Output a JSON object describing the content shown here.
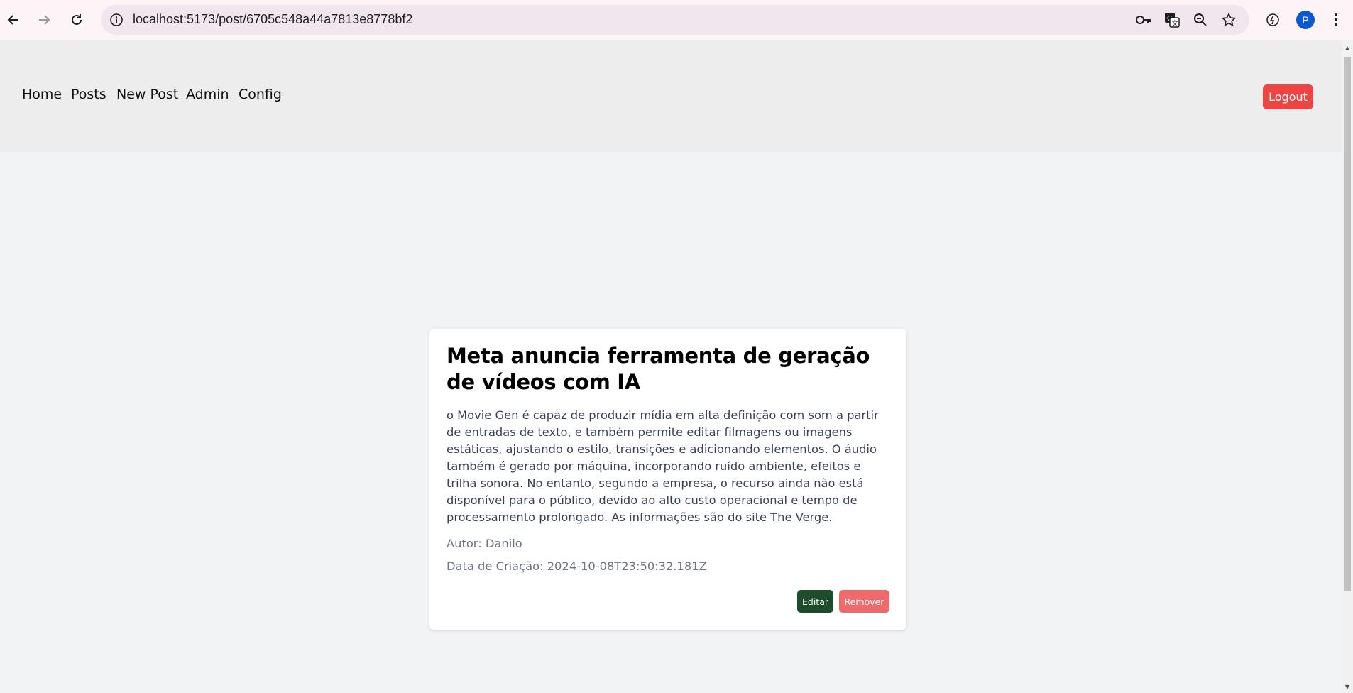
{
  "browser": {
    "url": "localhost:5173/post/6705c548a44a7813e8778bf2",
    "profile_initial": "P"
  },
  "nav": {
    "items": [
      "Home",
      "Posts",
      "New Post",
      "Admin",
      "Config"
    ],
    "logout_label": "Logout"
  },
  "post": {
    "title": "Meta anuncia ferramenta de geração de vídeos com IA",
    "content": "o Movie Gen é capaz de produzir mídia em alta definição com som a partir de entradas de texto, e também permite editar filmagens ou imagens estáticas, ajustando o estilo, transições e adicionando elementos. O áudio também é gerado por máquina, incorporando ruído ambiente, efeitos e trilha sonora. No entanto, segundo a empresa, o recurso ainda não está disponível para o público, devido ao alto custo operacional e tempo de processamento prolongado. As informações são do site The Verge.",
    "author": "Autor: Danilo",
    "created": "Data de Criação: 2024-10-08T23:50:32.181Z",
    "edit_label": "Editar",
    "remove_label": "Remover"
  },
  "colors": {
    "logout": "#ef4444",
    "edit": "#1e4d2b",
    "remove": "#ef6b6b",
    "header_bg": "#ededed",
    "page_bg": "#f2f3f5"
  }
}
